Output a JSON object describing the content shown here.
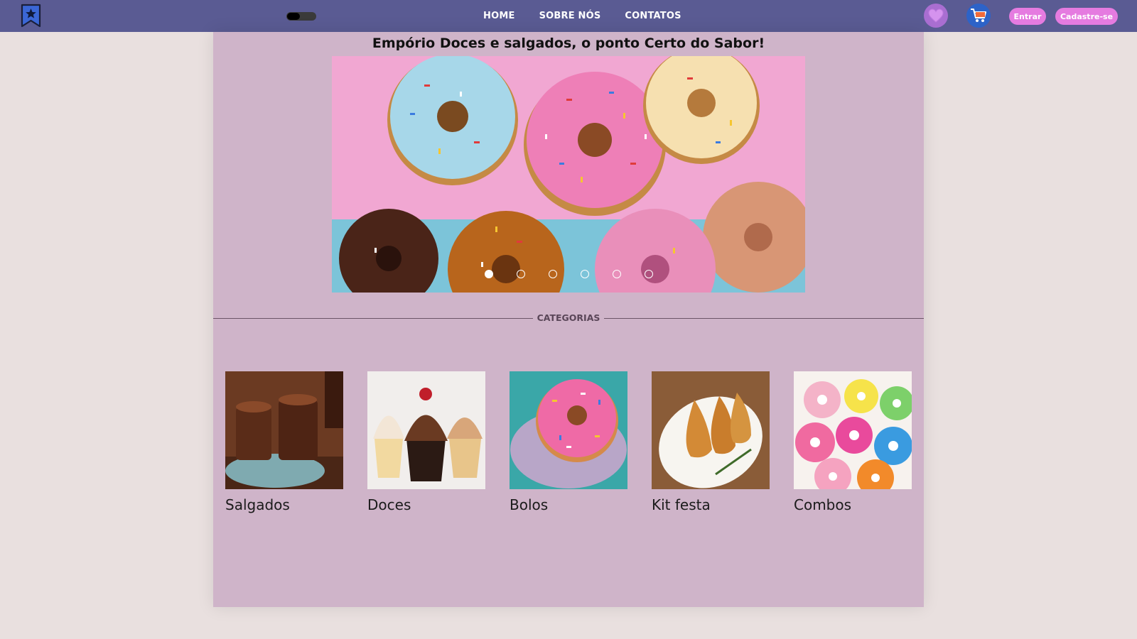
{
  "header": {
    "logo_icon": "bookmark-star-icon",
    "theme_toggle_icon": "toggle-switch-icon",
    "nav": [
      {
        "label": "HOME"
      },
      {
        "label": "SOBRE NÓS"
      },
      {
        "label": "CONTATOS"
      }
    ],
    "favorites_icon": "heart-icon",
    "cart_icon": "shopping-cart-icon",
    "login_label": "Entrar",
    "signup_label": "Cadastre-se"
  },
  "main": {
    "headline": "Empório Doces e salgados, o ponto Certo do Sabor!",
    "carousel": {
      "image": "colorful-donuts-image",
      "slides": 6,
      "active_slide": 1
    },
    "categories_label": "CATEGORIAS",
    "categories": [
      {
        "label": "Salgados",
        "image": "chocolate-mousse-cups-image"
      },
      {
        "label": "Doces",
        "image": "cupcakes-image"
      },
      {
        "label": "Bolos",
        "image": "pink-donut-image"
      },
      {
        "label": "Kit festa",
        "image": "coxinhas-plate-image"
      },
      {
        "label": "Combos",
        "image": "assorted-donuts-image"
      }
    ]
  },
  "colors": {
    "navbar": "#5a5b93",
    "panel": "#cfb4c9",
    "page_bg": "#e9e0df",
    "pill": "#e57be0",
    "favorites": "#a96ed1",
    "cart": "#2d63c8"
  }
}
